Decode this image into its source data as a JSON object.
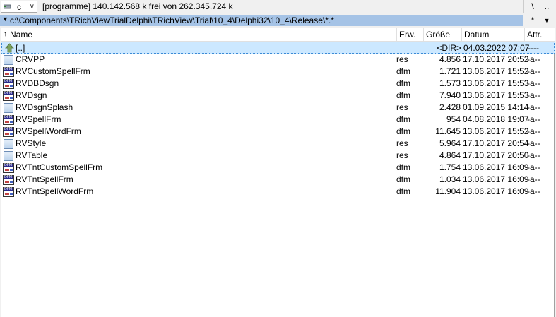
{
  "drive": {
    "letter": "c",
    "info": "[programme]  140.142.568 k frei von 262.345.724 k"
  },
  "toolbar": {
    "root_label": "\\",
    "up_label": "..",
    "star_label": "*",
    "history_label": "▼"
  },
  "path": {
    "text": "c:\\Components\\TRichViewTrialDelphi\\TRichView\\Trial\\10_4\\Delphi32\\10_4\\Release\\*.*"
  },
  "columns": {
    "name": "Name",
    "ext": "Erw.",
    "size": "Größe",
    "date": "Datum",
    "attr": "Attr."
  },
  "files": [
    {
      "name": "[..]",
      "ext": "",
      "size": "<DIR>",
      "date": "04.03.2022 07:07",
      "attr": "----",
      "icon": "up-folder-icon"
    },
    {
      "name": "CRVPP",
      "ext": "res",
      "size": "4.856",
      "date": "17.10.2017 20:52",
      "attr": "-a--",
      "icon": "res-file-icon"
    },
    {
      "name": "RVCustomSpellFrm",
      "ext": "dfm",
      "size": "1.721",
      "date": "13.06.2017 15:52",
      "attr": "-a--",
      "icon": "dfm-file-icon"
    },
    {
      "name": "RVDBDsgn",
      "ext": "dfm",
      "size": "1.573",
      "date": "13.06.2017 15:53",
      "attr": "-a--",
      "icon": "dfm-file-icon"
    },
    {
      "name": "RVDsgn",
      "ext": "dfm",
      "size": "7.940",
      "date": "13.06.2017 15:53",
      "attr": "-a--",
      "icon": "dfm-file-icon"
    },
    {
      "name": "RVDsgnSplash",
      "ext": "res",
      "size": "2.428",
      "date": "01.09.2015 14:14",
      "attr": "-a--",
      "icon": "res-file-icon"
    },
    {
      "name": "RVSpellFrm",
      "ext": "dfm",
      "size": "954",
      "date": "04.08.2018 19:07",
      "attr": "-a--",
      "icon": "dfm-file-icon"
    },
    {
      "name": "RVSpellWordFrm",
      "ext": "dfm",
      "size": "11.645",
      "date": "13.06.2017 15:52",
      "attr": "-a--",
      "icon": "dfm-file-icon"
    },
    {
      "name": "RVStyle",
      "ext": "res",
      "size": "5.964",
      "date": "17.10.2017 20:54",
      "attr": "-a--",
      "icon": "res-file-icon"
    },
    {
      "name": "RVTable",
      "ext": "res",
      "size": "4.864",
      "date": "17.10.2017 20:50",
      "attr": "-a--",
      "icon": "res-file-icon"
    },
    {
      "name": "RVTntCustomSpellFrm",
      "ext": "dfm",
      "size": "1.754",
      "date": "13.06.2017 16:09",
      "attr": "-a--",
      "icon": "dfm-file-icon"
    },
    {
      "name": "RVTntSpellFrm",
      "ext": "dfm",
      "size": "1.034",
      "date": "13.06.2017 16:09",
      "attr": "-a--",
      "icon": "dfm-file-icon"
    },
    {
      "name": "RVTntSpellWordFrm",
      "ext": "dfm",
      "size": "11.904",
      "date": "13.06.2017 16:09",
      "attr": "-a--",
      "icon": "dfm-file-icon"
    }
  ],
  "colors": {
    "path_bar": "#a5c3e6",
    "selection": "#cce8ff"
  }
}
